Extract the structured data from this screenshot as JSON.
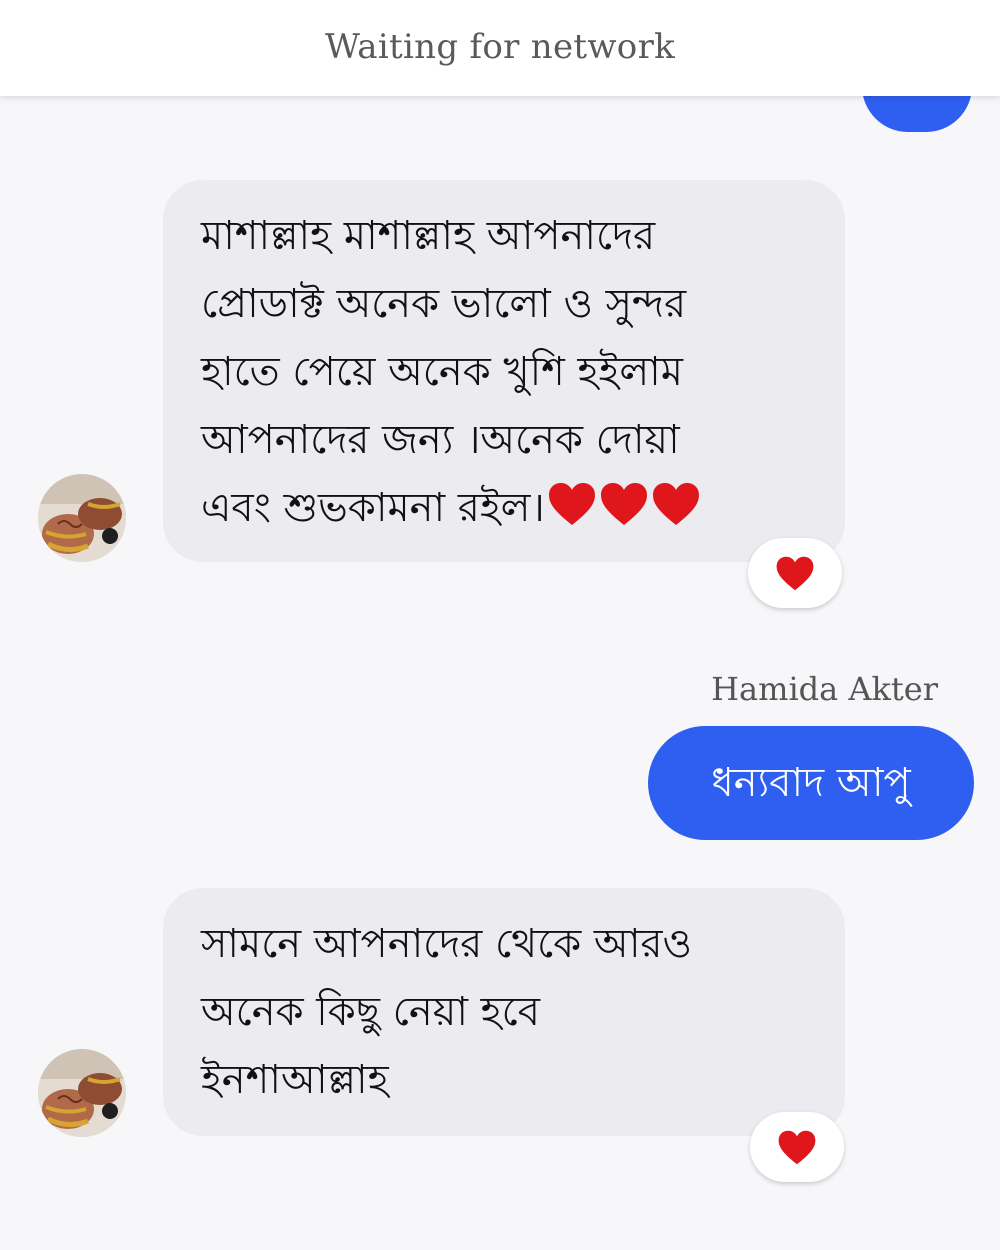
{
  "status_bar": {
    "title": "Waiting for network"
  },
  "colors": {
    "outgoing_bubble": "#2f5ff0",
    "incoming_bubble": "#ebebf0",
    "heart": "#e0161d"
  },
  "messages": [
    {
      "direction": "incoming",
      "text": "মাশাল্লাহ মাশাল্লাহ আপনাদের\nপ্রোডাক্ট অনেক ভালো ও সুন্দর\nহাতে পেয়ে অনেক খুশি হইলাম\nআপনাদের জন্য ।অনেক দোয়া\nএবং শুভকামনা রইল।",
      "emoji": [
        "red-heart",
        "red-heart",
        "red-heart"
      ],
      "reaction": "red-heart"
    },
    {
      "direction": "outgoing",
      "sender": "Hamida Akter",
      "text": "ধন্যবাদ আপু"
    },
    {
      "direction": "incoming",
      "text": "সামনে আপনাদের থেকে আরও\nঅনেক কিছু নেয়া হবে\nইনশাআল্লাহ",
      "reaction": "red-heart"
    }
  ]
}
